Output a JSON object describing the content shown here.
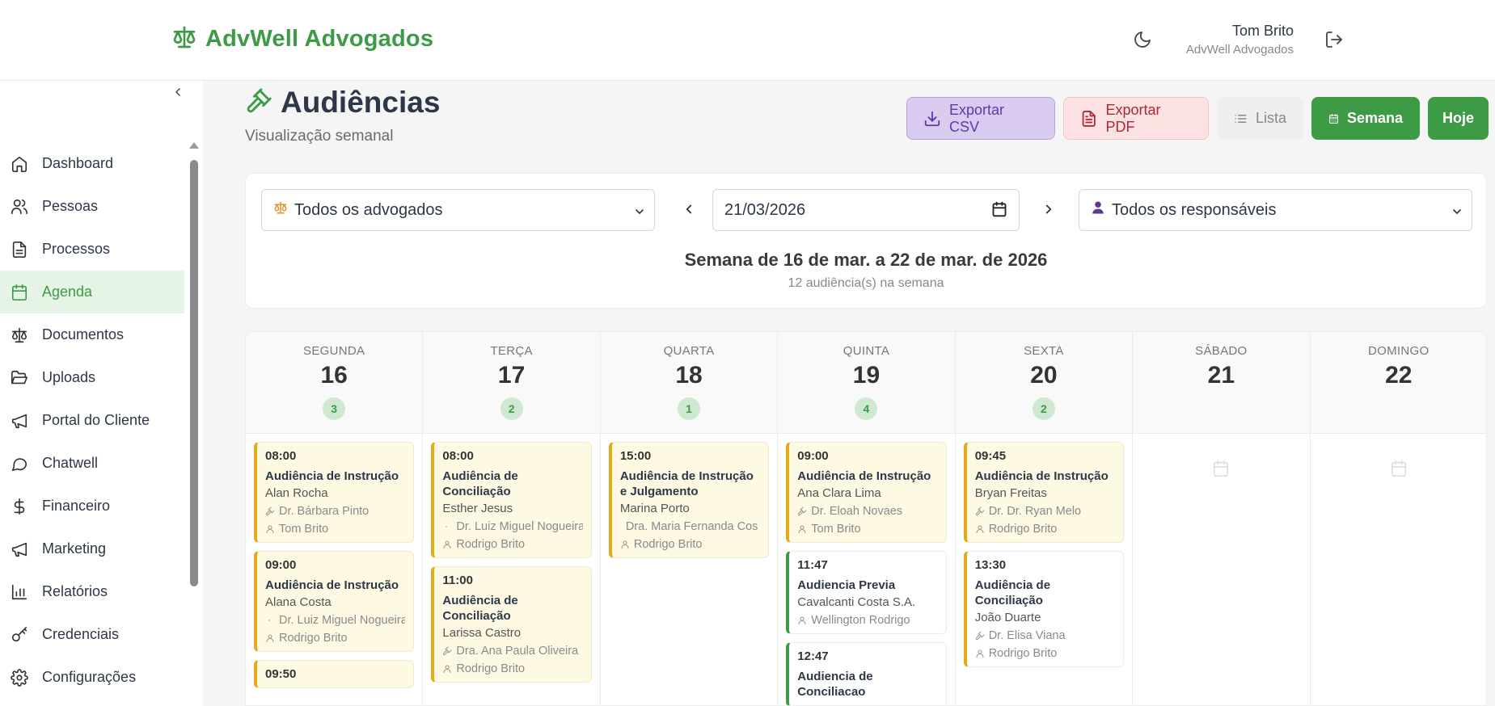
{
  "header": {
    "brand": "AdvWell Advogados",
    "user_name": "Tom Brito",
    "user_org": "AdvWell Advogados"
  },
  "sidebar": {
    "items": [
      {
        "label": "Dashboard",
        "icon": "home-icon"
      },
      {
        "label": "Pessoas",
        "icon": "users-icon"
      },
      {
        "label": "Processos",
        "icon": "file-text-icon"
      },
      {
        "label": "Agenda",
        "icon": "calendar-icon",
        "active": true
      },
      {
        "label": "Documentos",
        "icon": "scale-icon"
      },
      {
        "label": "Uploads",
        "icon": "folder-open-icon"
      },
      {
        "label": "Portal do Cliente",
        "icon": "megaphone-icon"
      },
      {
        "label": "Chatwell",
        "icon": "chat-bubble-icon"
      },
      {
        "label": "Financeiro",
        "icon": "dollar-icon"
      },
      {
        "label": "Marketing",
        "icon": "megaphone-icon"
      },
      {
        "label": "Relatórios",
        "icon": "bar-chart-icon"
      },
      {
        "label": "Credenciais",
        "icon": "key-icon"
      },
      {
        "label": "Configurações",
        "icon": "gear-icon"
      }
    ]
  },
  "page": {
    "title": "Audiências",
    "subtitle": "Visualização semanal"
  },
  "actions": {
    "export_csv": "Exportar CSV",
    "export_pdf": "Exportar PDF",
    "list": "Lista",
    "week": "Semana",
    "today": "Hoje"
  },
  "filters": {
    "lawyer_select": "Todos os advogados",
    "date_value": "21/03/2026",
    "responsible_select": "Todos os responsáveis",
    "week_title": "Semana de 16 de mar. a 22 de mar. de 2026",
    "week_count": "12 audiência(s) na semana"
  },
  "colors": {
    "brand_green": "#3d9b46",
    "event_yellow": "#e5a91a",
    "csv_purple": "#5b3ba8",
    "pdf_red": "#b32633"
  },
  "calendar": {
    "days": [
      {
        "name": "SEGUNDA",
        "num": "16",
        "count": "3",
        "events": [
          {
            "time": "08:00",
            "title": "Audiência de Instrução",
            "client": "Alan Rocha",
            "lawyer": "Dr. Bárbara Pinto",
            "lawyer_icon": "gavel",
            "resp": "Tom Brito",
            "color": "yellow"
          },
          {
            "time": "09:00",
            "title": "Audiência de Instrução",
            "client": "Alana Costa",
            "lawyer": "Dr. Luiz Miguel Nogueira",
            "lawyer_icon": "dot",
            "resp": "Rodrigo Brito",
            "color": "yellow"
          },
          {
            "time": "09:50",
            "title": "",
            "client": "",
            "lawyer": "",
            "lawyer_icon": "gavel",
            "resp": "",
            "color": "yellow"
          }
        ]
      },
      {
        "name": "TERÇA",
        "num": "17",
        "count": "2",
        "events": [
          {
            "time": "08:00",
            "title": "Audiência de Conciliação",
            "client": "Esther Jesus",
            "lawyer": "Dr. Luiz Miguel Nogueira",
            "lawyer_icon": "dot",
            "resp": "Rodrigo Brito",
            "color": "yellow"
          },
          {
            "time": "11:00",
            "title": "Audiência de Conciliação",
            "client": "Larissa Castro",
            "lawyer": "Dra. Ana Paula Oliveira",
            "lawyer_icon": "gavel",
            "resp": "Rodrigo Brito",
            "color": "yellow"
          }
        ]
      },
      {
        "name": "QUARTA",
        "num": "18",
        "count": "1",
        "events": [
          {
            "time": "15:00",
            "title": "Audiência de Instrução e Julgamento",
            "client": "Marina Porto",
            "lawyer": "Dra. Maria Fernanda Cos",
            "lawyer_icon": "none",
            "resp": "Rodrigo Brito",
            "color": "yellow"
          }
        ]
      },
      {
        "name": "QUINTA",
        "num": "19",
        "count": "4",
        "events": [
          {
            "time": "09:00",
            "title": "Audiência de Instrução",
            "client": "Ana Clara Lima",
            "lawyer": "Dr. Eloah Novaes",
            "lawyer_icon": "gavel",
            "resp": "Tom Brito",
            "color": "yellow"
          },
          {
            "time": "11:47",
            "title": "Audiencia Previa",
            "client": "Cavalcanti Costa S.A.",
            "lawyer": "",
            "lawyer_icon": "none",
            "resp": "Wellington Rodrigo",
            "color": "green"
          },
          {
            "time": "12:47",
            "title": "Audiencia de Conciliacao",
            "client": "",
            "lawyer": "",
            "lawyer_icon": "none",
            "resp": "",
            "color": "green"
          }
        ]
      },
      {
        "name": "SEXTA",
        "num": "20",
        "count": "2",
        "events": [
          {
            "time": "09:45",
            "title": "Audiência de Instrução",
            "client": "Bryan Freitas",
            "lawyer": "Dr. Dr. Ryan Melo",
            "lawyer_icon": "gavel",
            "resp": "Rodrigo Brito",
            "color": "yellow"
          },
          {
            "time": "13:30",
            "title": "Audiência de Conciliação",
            "client": "João Duarte",
            "lawyer": "Dr. Elisa Viana",
            "lawyer_icon": "gavel",
            "resp": "Rodrigo Brito",
            "color": "white"
          }
        ]
      },
      {
        "name": "SÁBADO",
        "num": "21",
        "count": "",
        "events": []
      },
      {
        "name": "DOMINGO",
        "num": "22",
        "count": "",
        "events": []
      }
    ]
  }
}
